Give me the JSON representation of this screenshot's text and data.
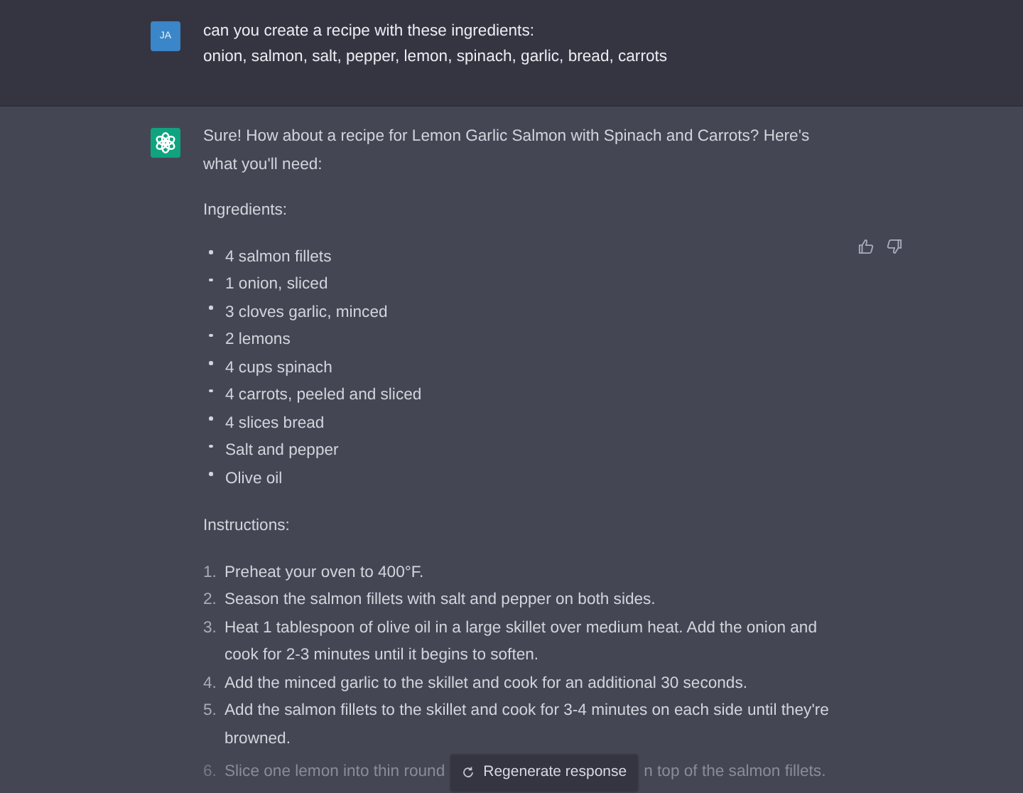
{
  "user_message": {
    "avatar": "JA",
    "lines": [
      "can you create a recipe with these ingredients:",
      "onion, salmon, salt, pepper, lemon, spinach, garlic, bread, carrots"
    ]
  },
  "assistant_message": {
    "intro": "Sure! How about a recipe for Lemon Garlic Salmon with Spinach and Carrots? Here's what you'll need:",
    "ingredients_heading": "Ingredients:",
    "ingredients": [
      "4 salmon fillets",
      "1 onion, sliced",
      "3 cloves garlic, minced",
      "2 lemons",
      "4 cups spinach",
      "4 carrots, peeled and sliced",
      "4 slices bread",
      "Salt and pepper",
      "Olive oil"
    ],
    "instructions_heading": "Instructions:",
    "steps": [
      {
        "number": "1.",
        "text": "Preheat your oven to 400°F."
      },
      {
        "number": "2.",
        "text": "Season the salmon fillets with salt and pepper on both sides."
      },
      {
        "number": "3.",
        "text": "Heat 1 tablespoon of olive oil in a large skillet over medium heat. Add the onion and cook for 2-3 minutes until it begins to soften."
      },
      {
        "number": "4.",
        "text": "Add the minced garlic to the skillet and cook for an additional 30 seconds."
      },
      {
        "number": "5.",
        "text": "Add the salmon fillets to the skillet and cook for 3-4 minutes on each side until they're browned."
      }
    ],
    "partial_step": {
      "number": "6.",
      "text_before": "Slice one lemon into thin round",
      "text_after": "n top of the salmon fillets."
    }
  },
  "regenerate_button": {
    "label": "Regenerate response"
  }
}
